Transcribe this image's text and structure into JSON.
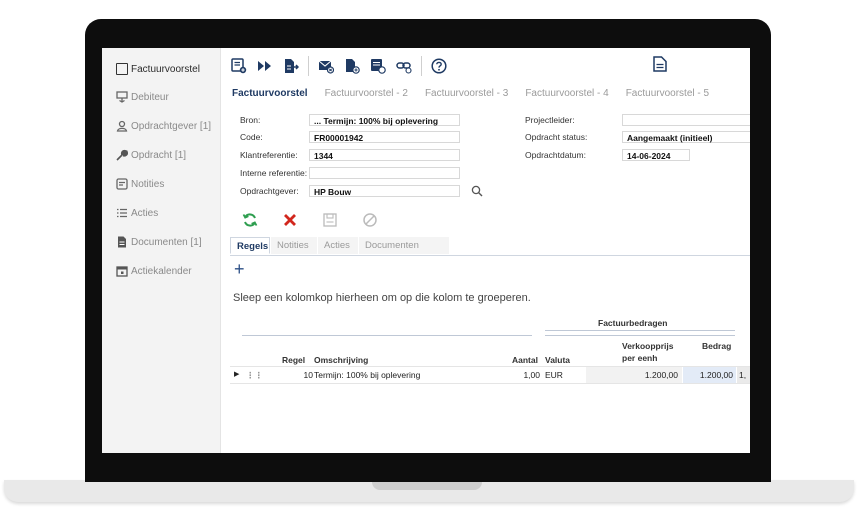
{
  "sidebar": {
    "items": [
      {
        "label": "Factuurvoorstel"
      },
      {
        "label": "Debiteur"
      },
      {
        "label": "Opdrachtgever [1]"
      },
      {
        "label": "Opdracht [1]"
      },
      {
        "label": "Notities"
      },
      {
        "label": "Acties"
      },
      {
        "label": "Documenten [1]"
      },
      {
        "label": "Actiekalender"
      }
    ]
  },
  "tabs": [
    {
      "label": "Factuurvoorstel"
    },
    {
      "label": "Factuurvoorstel - 2"
    },
    {
      "label": "Factuurvoorstel - 3"
    },
    {
      "label": "Factuurvoorstel - 4"
    },
    {
      "label": "Factuurvoorstel - 5"
    }
  ],
  "form": {
    "bron_label": "Bron:",
    "bron_value": "... Termijn: 100% bij oplevering",
    "code_label": "Code:",
    "code_value": "FR00001942",
    "klantref_label": "Klantreferentie:",
    "klantref_value": "1344",
    "interne_label": "Interne referentie:",
    "interne_value": "",
    "opdrachtgever_label": "Opdrachtgever:",
    "opdrachtgever_value": "HP Bouw",
    "projectleider_label": "Projectleider:",
    "projectleider_value": "",
    "status_label": "Opdracht status:",
    "status_value": "Aangemaakt (initieel)",
    "datum_label": "Opdrachtdatum:",
    "datum_value": "14-06-2024"
  },
  "subtabs": [
    {
      "label": "Regels"
    },
    {
      "label": "Notities"
    },
    {
      "label": "Acties"
    },
    {
      "label": "Documenten"
    }
  ],
  "grid": {
    "group_hint": "Sleep een kolomkop hierheen om op die kolom te groeperen.",
    "band_header": "Factuurbedragen",
    "headers": {
      "regel": "Regel",
      "omschrijving": "Omschrijving",
      "aantal": "Aantal",
      "valuta": "Valuta",
      "verkoopprijs_1": "Verkoopprijs",
      "verkoopprijs_2": "per eenh",
      "bedrag": "Bedrag"
    },
    "rows": [
      {
        "regel": "10",
        "omschrijving": "Termijn: 100% bij oplevering",
        "aantal": "1,00",
        "valuta": "EUR",
        "verkoopprijs": "1.200,00",
        "bedrag": "1.200,00",
        "extra": "1,"
      }
    ]
  },
  "colors": {
    "accent": "#1f3a63",
    "refresh": "#2e9e4f",
    "delete": "#d2271d"
  }
}
